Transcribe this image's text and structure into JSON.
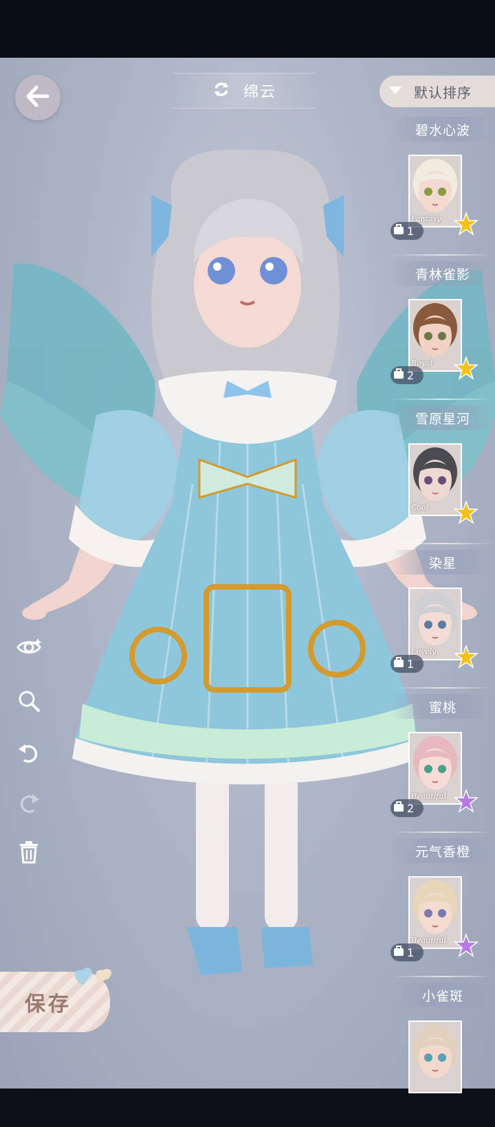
{
  "header": {
    "title": "绵云",
    "sort_label": "默认排序"
  },
  "save_label": "保存",
  "list": [
    {
      "name": "碧水心波",
      "tag": "Fantasy",
      "count": "1",
      "star": "gold",
      "hair": "#f1ece0",
      "skin": "#f3d9cf",
      "eye": "#8a9a45"
    },
    {
      "name": "青林雀影",
      "tag": "Royal",
      "count": "2",
      "star": "gold",
      "hair": "#8a5a3c",
      "skin": "#f0d3c4",
      "eye": "#6b7a45"
    },
    {
      "name": "雪原星河",
      "tag": "Cool",
      "count": "",
      "star": "gold",
      "hair": "#4a4a50",
      "skin": "#eed8d2",
      "eye": "#6a4e7a"
    },
    {
      "name": "染星",
      "tag": "Lovely",
      "count": "1",
      "star": "gold",
      "hair": "#cfcfd4",
      "skin": "#f4dcd6",
      "eye": "#5b7ea0"
    },
    {
      "name": "蜜桃",
      "tag": "Beautiful",
      "count": "2",
      "star": "purple",
      "hair": "#e8b8c0",
      "skin": "#f6dcd6",
      "eye": "#4aa08a"
    },
    {
      "name": "元气香橙",
      "tag": "Beautiful",
      "count": "1",
      "star": "purple",
      "hair": "#e8d6b8",
      "skin": "#f3dccf",
      "eye": "#7a7ab0"
    },
    {
      "name": "小雀斑",
      "tag": "",
      "count": "",
      "star": "",
      "hair": "#e0d0bc",
      "skin": "#f3d8cc",
      "eye": "#5aa0b0"
    }
  ],
  "colors": {
    "gold_star": "#f2c21a",
    "purple_star": "#b57be0",
    "dress": "#8ec6dc",
    "accent_gold": "#d49a2e"
  }
}
